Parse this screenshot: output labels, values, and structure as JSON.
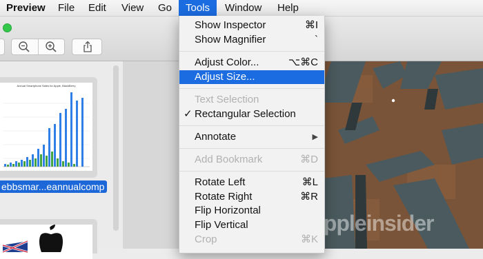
{
  "menubar": {
    "items": [
      {
        "label": "Preview",
        "app": true
      },
      {
        "label": "File"
      },
      {
        "label": "Edit"
      },
      {
        "label": "View"
      },
      {
        "label": "Go"
      },
      {
        "label": "Tools",
        "active": true
      },
      {
        "label": "Window"
      },
      {
        "label": "Help"
      }
    ]
  },
  "toolbar": {
    "buttons": [
      "zoom-out-icon",
      "zoom-in-icon",
      "share-icon"
    ]
  },
  "sidebar": {
    "thumb_title": "Annual Smartphone Sales for Apple, BlackBerry",
    "thumb_label": "ebbsmar...eannualcomp"
  },
  "tools_menu": {
    "items": [
      {
        "label": "Show Inspector",
        "shortcut": "⌘I"
      },
      {
        "label": "Show Magnifier",
        "shortcut": "`"
      },
      {
        "label": "Adjust Color...",
        "shortcut": "⌥⌘C"
      },
      {
        "label": "Adjust Size...",
        "shortcut": "",
        "highlighted": true
      },
      {
        "label": "Text Selection",
        "shortcut": "",
        "disabled": true
      },
      {
        "label": "Rectangular Selection",
        "shortcut": "",
        "checked": true
      },
      {
        "label": "Annotate",
        "shortcut": "▶"
      },
      {
        "label": "Add Bookmark",
        "shortcut": "⌘D",
        "disabled": true
      },
      {
        "label": "Rotate Left",
        "shortcut": "⌘L"
      },
      {
        "label": "Rotate Right",
        "shortcut": "⌘R"
      },
      {
        "label": "Flip Horizontal",
        "shortcut": ""
      },
      {
        "label": "Flip Vertical",
        "shortcut": ""
      },
      {
        "label": "Crop",
        "shortcut": "⌘K",
        "disabled": true
      }
    ],
    "checkmark": "✓"
  },
  "content": {
    "watermark": "appleinsider"
  },
  "colors": {
    "accent": "#1b6ce0",
    "thumb_bar_blue": "#2f7fe6",
    "thumb_bar_green": "#3fa33f"
  }
}
